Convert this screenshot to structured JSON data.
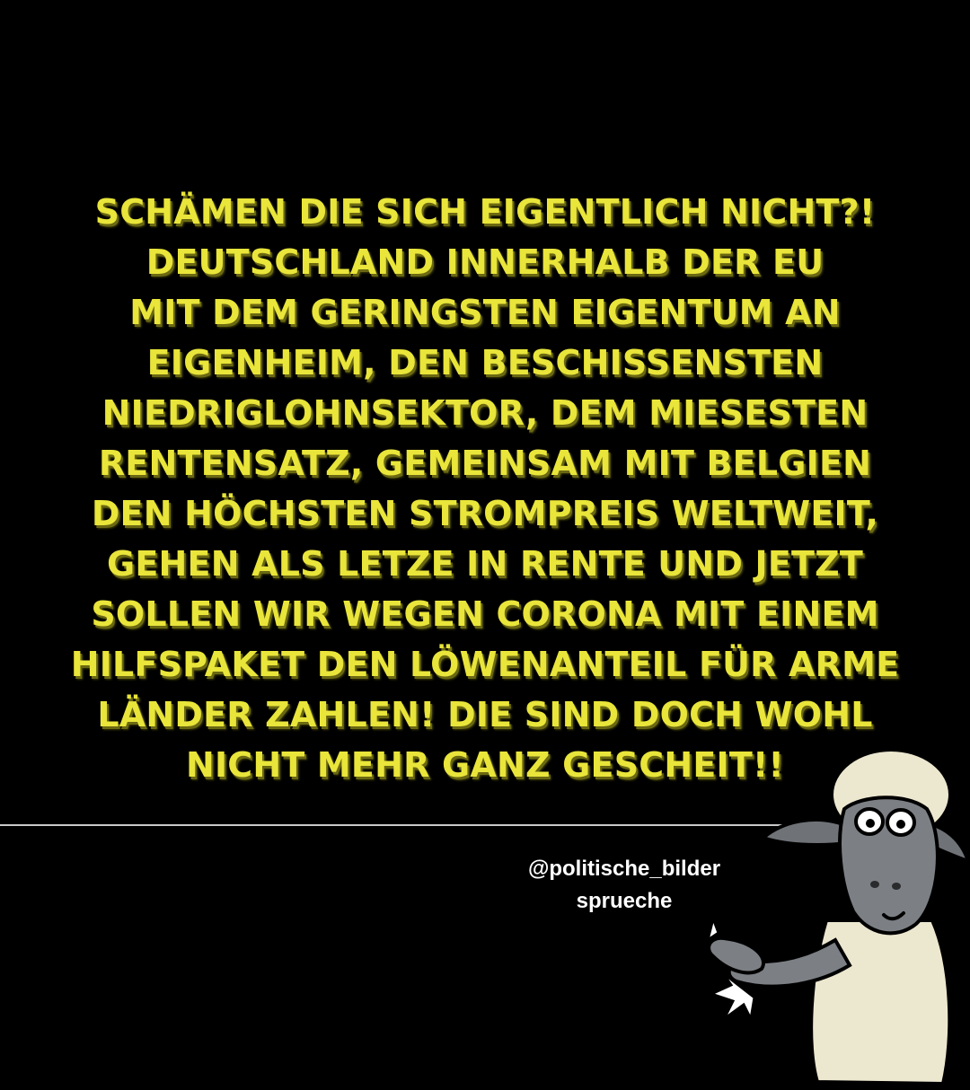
{
  "quote": {
    "lines": [
      "SCHÄMEN DIE SICH EIGENTLICH NICHT?!",
      "DEUTSCHLAND INNERHALB DER EU",
      "MIT DEM GERINGSTEN EIGENTUM AN",
      "EIGENHEIM, DEN BESCHISSENSTEN",
      "NIEDRIGLOHNSEKTOR, DEM MIESESTEN",
      "RENTENSATZ, GEMEINSAM MIT BELGIEN",
      "DEN HÖCHSTEN STROMPREIS WELTWEIT,",
      "GEHEN ALS LETZE IN RENTE UND JETZT",
      "SOLLEN WIR WEGEN CORONA MIT EINEM",
      "HILFSPAKET  DEN LÖWENANTEIL FÜR ARME",
      "LÄNDER ZAHLEN! DIE SIND DOCH WOHL",
      "NICHT MEHR GANZ GESCHEIT!!"
    ],
    "color": "#e9e53a"
  },
  "credit": {
    "line1": "@politische_bilder",
    "line2": "sprueche"
  },
  "illustration": {
    "icon": "cartoon-sheep-illustration"
  },
  "colors": {
    "background": "#000000",
    "divider": "#c9c9c9"
  }
}
